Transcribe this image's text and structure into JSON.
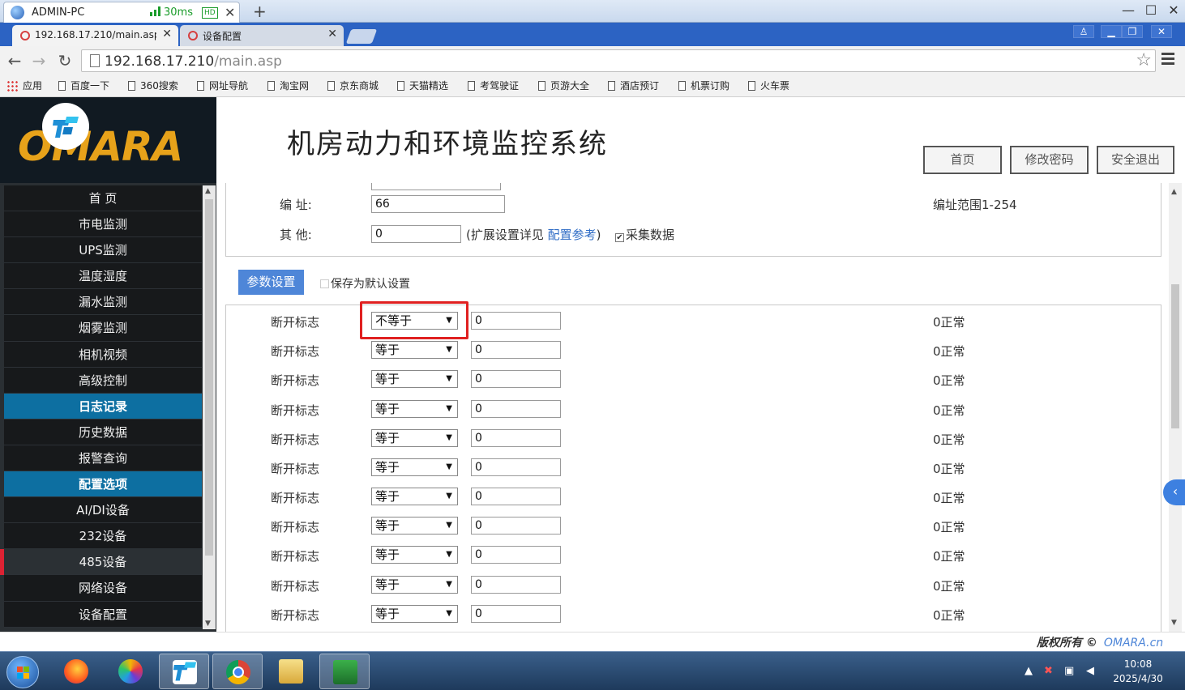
{
  "outer_window": {
    "tab_title": "ADMIN-PC",
    "latency": "30ms",
    "quality_badge": "HD"
  },
  "browser": {
    "tabs": [
      {
        "title": "192.168.17.210/main.asp",
        "active": true
      },
      {
        "title": "设备配置",
        "active": false
      }
    ],
    "url_host": "192.168.17.210",
    "url_path": "/main.asp",
    "bookmarks": [
      "应用",
      "百度一下",
      "360搜索",
      "网址导航",
      "淘宝网",
      "京东商城",
      "天猫精选",
      "考驾驶证",
      "页游大全",
      "酒店预订",
      "机票订购",
      "火车票"
    ]
  },
  "header": {
    "logo_text": "OMARA",
    "system_title": "机房动力和环境监控系统",
    "buttons": [
      "首页",
      "修改密码",
      "安全退出"
    ]
  },
  "sidebar": {
    "items": [
      {
        "label": "首 页",
        "type": "item"
      },
      {
        "label": "市电监测",
        "type": "item"
      },
      {
        "label": "UPS监测",
        "type": "item"
      },
      {
        "label": "温度湿度",
        "type": "item"
      },
      {
        "label": "漏水监测",
        "type": "item"
      },
      {
        "label": "烟雾监测",
        "type": "item"
      },
      {
        "label": "相机视频",
        "type": "item"
      },
      {
        "label": "高级控制",
        "type": "item"
      },
      {
        "label": "日志记录",
        "type": "header"
      },
      {
        "label": "历史数据",
        "type": "item"
      },
      {
        "label": "报警查询",
        "type": "item"
      },
      {
        "label": "配置选项",
        "type": "header"
      },
      {
        "label": "AI/DI设备",
        "type": "item"
      },
      {
        "label": "232设备",
        "type": "item"
      },
      {
        "label": "485设备",
        "type": "item"
      },
      {
        "label": "网络设备",
        "type": "item"
      },
      {
        "label": "设备配置",
        "type": "item"
      }
    ]
  },
  "form": {
    "address_label": "编 址:",
    "address_value": "66",
    "address_range": "编址范围1-254",
    "other_label": "其 他:",
    "other_value": "0",
    "other_hint_prefix": "(扩展设置详见",
    "other_hint_link": "配置参考",
    "other_hint_suffix": ")",
    "collect_label": "采集数据",
    "param_button": "参数设置",
    "save_default_label": "保存为默认设置"
  },
  "params": [
    {
      "label": "断开标志",
      "operator": "不等于",
      "value": "0",
      "status": "0正常"
    },
    {
      "label": "断开标志",
      "operator": "等于",
      "value": "0",
      "status": "0正常"
    },
    {
      "label": "断开标志",
      "operator": "等于",
      "value": "0",
      "status": "0正常"
    },
    {
      "label": "断开标志",
      "operator": "等于",
      "value": "0",
      "status": "0正常"
    },
    {
      "label": "断开标志",
      "operator": "等于",
      "value": "0",
      "status": "0正常"
    },
    {
      "label": "断开标志",
      "operator": "等于",
      "value": "0",
      "status": "0正常"
    },
    {
      "label": "断开标志",
      "operator": "等于",
      "value": "0",
      "status": "0正常"
    },
    {
      "label": "断开标志",
      "operator": "等于",
      "value": "0",
      "status": "0正常"
    },
    {
      "label": "断开标志",
      "operator": "等于",
      "value": "0",
      "status": "0正常"
    },
    {
      "label": "断开标志",
      "operator": "等于",
      "value": "0",
      "status": "0正常"
    },
    {
      "label": "断开标志",
      "operator": "等于",
      "value": "0",
      "status": "0正常"
    }
  ],
  "footer": {
    "copyright": "版权所有 ©",
    "brand": "OMARA.cn"
  },
  "taskbar": {
    "time": "10:08",
    "date": "2025/4/30"
  },
  "colors": {
    "sidebar_header": "#0d6fa1",
    "param_button": "#4e86d8",
    "logo_text": "#e7a21a",
    "highlight_border": "#e02020"
  }
}
